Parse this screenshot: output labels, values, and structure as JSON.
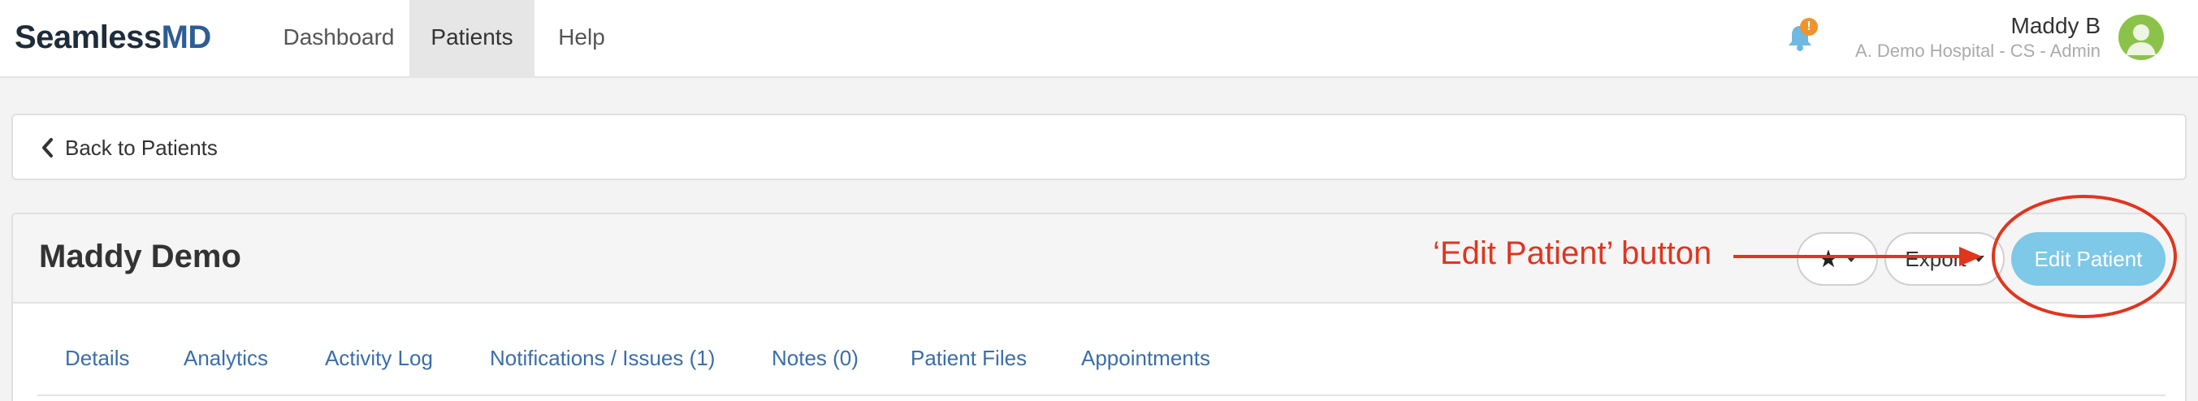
{
  "header": {
    "logo_part1": "Seamless",
    "logo_part2": "MD",
    "nav": [
      {
        "label": "Dashboard"
      },
      {
        "label": "Patients"
      },
      {
        "label": "Help"
      }
    ],
    "notification_badge": "!",
    "user_name": "Maddy B",
    "user_org": "A. Demo Hospital - CS - Admin"
  },
  "back": {
    "label": "Back to Patients"
  },
  "patient": {
    "name": "Maddy Demo",
    "export_label": "Export",
    "edit_label": "Edit Patient",
    "star_glyph": "★"
  },
  "tabs": [
    {
      "label": "Details"
    },
    {
      "label": "Analytics"
    },
    {
      "label": "Activity Log"
    },
    {
      "label": "Notifications / Issues (1)"
    },
    {
      "label": "Notes (0)"
    },
    {
      "label": "Patient Files"
    },
    {
      "label": "Appointments"
    }
  ],
  "annotation": {
    "text": "‘Edit Patient’ button",
    "color": "#e0351f"
  },
  "colors": {
    "brand_dark": "#1f2c3a",
    "brand_blue": "#2e5c95",
    "link": "#3a6ea8",
    "primary_button": "#7ec8e8",
    "badge": "#f0932b"
  }
}
